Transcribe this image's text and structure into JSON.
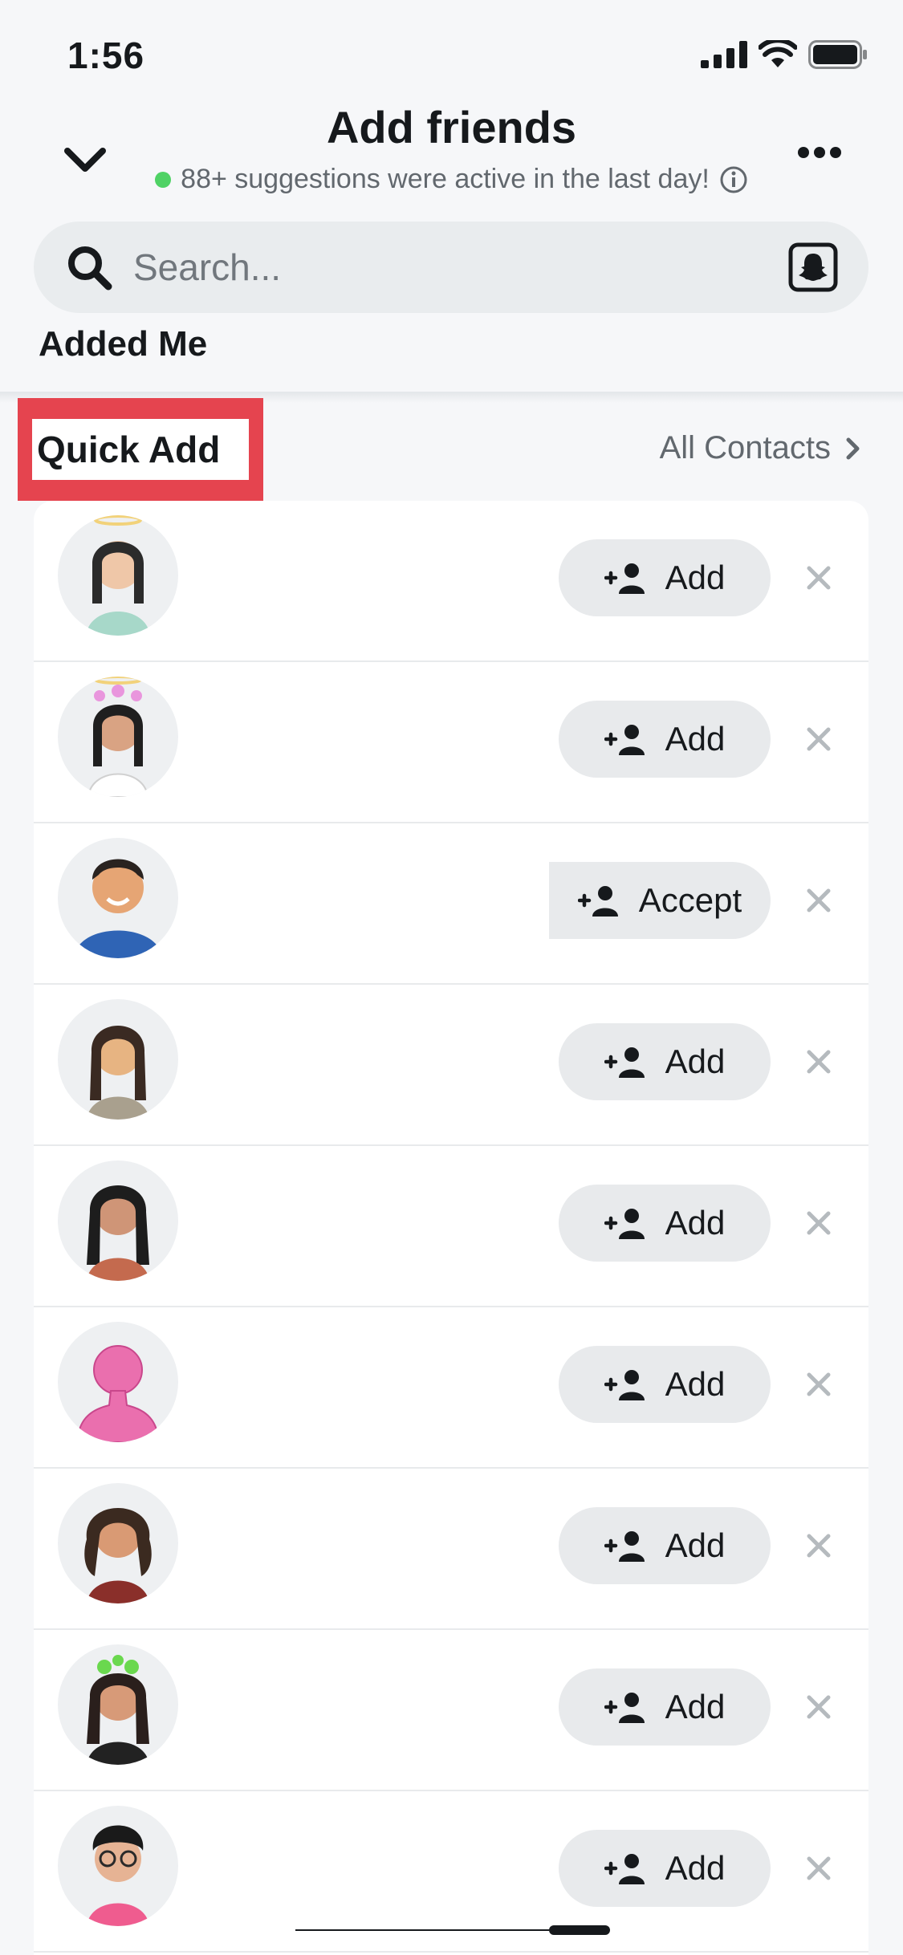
{
  "status_bar": {
    "time": "1:56",
    "icons": [
      "signal-icon",
      "wifi-icon",
      "battery-icon"
    ]
  },
  "header": {
    "title": "Add friends",
    "subtitle": "88+ suggestions were active in the last day!",
    "icons": [
      "chevron-down-icon",
      "more-icon",
      "info-icon"
    ]
  },
  "search": {
    "placeholder": "Search..."
  },
  "sections": {
    "added_me": "Added Me",
    "quick_add": "Quick Add",
    "all_contacts": "All Contacts"
  },
  "items": [
    {
      "action": "Add"
    },
    {
      "action": "Add"
    },
    {
      "action": "Accept"
    },
    {
      "action": "Add"
    },
    {
      "action": "Add"
    },
    {
      "action": "Add"
    },
    {
      "action": "Add"
    },
    {
      "action": "Add"
    },
    {
      "action": "Add"
    }
  ],
  "colors": {
    "background": "#f6f7f9",
    "highlight": "#e5444f",
    "online": "#4fd265",
    "button": "#e8eaec"
  }
}
